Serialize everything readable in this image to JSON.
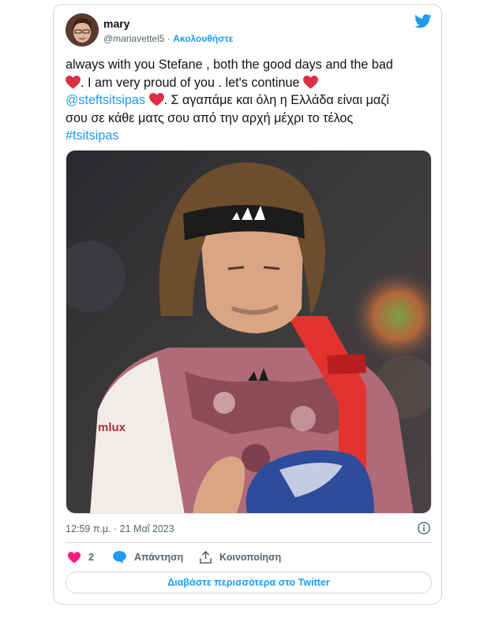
{
  "user": {
    "name": "mary",
    "handle": "@mariavettel5",
    "separator": "·",
    "follow_label": "Ακολουθήστε"
  },
  "tweet": {
    "line1": "always with you Stefane , both the good days and the bad",
    "line2_text": ". I am very proud of you . let's continue",
    "mention": "@steftsitsipas",
    "line3_text": ". Σ αγαπάμε και όλη η Ελλάδα είναι μαζί",
    "line4": "σου σε κάθε ματς σου από την αρχή μέχρι το τέλος",
    "hashtag": "#tsitsipas",
    "emoji": "red-heart"
  },
  "meta": {
    "time": "12:59 π.μ.",
    "separator": "·",
    "date": "21 Μαΐ 2023"
  },
  "actions": {
    "like_count": "2",
    "reply_label": "Απάντηση",
    "share_label": "Κοινοποίηση"
  },
  "read_more_label": "Διαβάστε περισσότερα στο Twitter",
  "icons": {
    "twitter": "twitter-bird-icon",
    "info": "info-icon",
    "like": "heart-icon",
    "reply": "reply-bubble-icon",
    "share": "share-upload-icon"
  },
  "colors": {
    "accent": "#1d9bf0",
    "heart": "#f91880",
    "emoji_heart": "#dd2e44",
    "secondary_text": "#536471",
    "border": "#cfd9de"
  }
}
